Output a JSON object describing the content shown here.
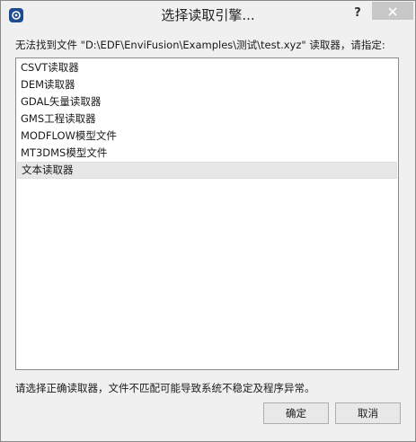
{
  "window": {
    "title": "选择读取引擎...",
    "help_label": "?",
    "close_icon": "close-icon",
    "app_icon": "app-logo-icon"
  },
  "instruction": "无法找到文件 \"D:\\EDF\\EnviFusion\\Examples\\测试\\test.xyz\" 读取器，请指定:",
  "readers": [
    {
      "label": "CSVT读取器"
    },
    {
      "label": "DEM读取器"
    },
    {
      "label": "GDAL矢量读取器"
    },
    {
      "label": "GMS工程读取器"
    },
    {
      "label": "MODFLOW模型文件"
    },
    {
      "label": "MT3DMS模型文件"
    },
    {
      "label": "文本读取器"
    }
  ],
  "hovered_reader": "文本读取器",
  "warning": "请选择正确读取器，文件不匹配可能导致系统不稳定及程序异常。",
  "buttons": {
    "ok_label": "确定",
    "cancel_label": "取消"
  },
  "colors": {
    "window_bg": "#f0f0f0",
    "list_bg": "#ffffff",
    "hover_bg": "#e7e7e7",
    "close_button_bg": "#c7c7c7",
    "app_icon_bg": "#1f4c8e"
  }
}
